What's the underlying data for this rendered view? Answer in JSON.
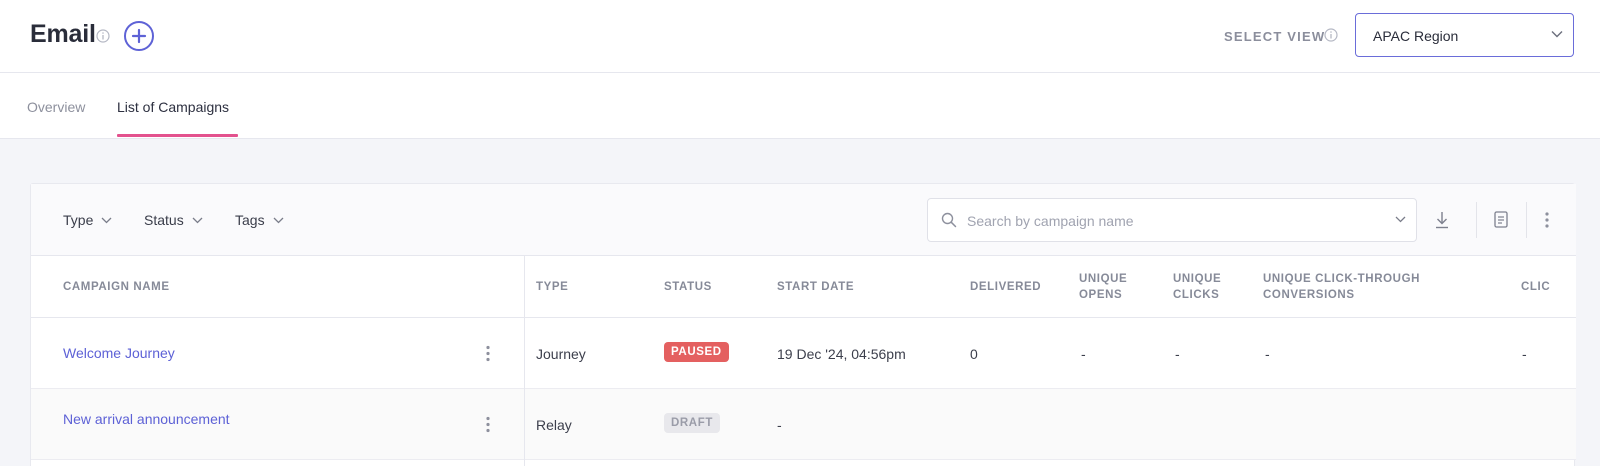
{
  "header": {
    "title": "Email",
    "select_view_label": "SELECT VIEW",
    "selected_view": "APAC Region"
  },
  "tabs": [
    {
      "label": "Overview",
      "active": false
    },
    {
      "label": "List of Campaigns",
      "active": true
    }
  ],
  "toolbar": {
    "filters": [
      "Type",
      "Status",
      "Tags"
    ],
    "search_placeholder": "Search by campaign name"
  },
  "table": {
    "columns": [
      "CAMPAIGN NAME",
      "TYPE",
      "STATUS",
      "START DATE",
      "DELIVERED",
      "UNIQUE\nOPENS",
      "UNIQUE\nCLICKS",
      "UNIQUE CLICK-THROUGH\nCONVERSIONS",
      "CLIC"
    ],
    "rows": [
      {
        "name": "Welcome Journey",
        "type": "Journey",
        "status": "PAUSED",
        "start_date": "19 Dec '24, 04:56pm",
        "delivered": "0",
        "unique_opens": "-",
        "unique_clicks": "-",
        "unique_ctc": "-",
        "clicks": "-"
      },
      {
        "name": "New arrival announcement",
        "type": "Relay",
        "status": "DRAFT",
        "start_date": "-"
      }
    ]
  },
  "colors": {
    "accent": "#5e62d6",
    "tab_underline": "#e3528e",
    "paused": "#e46060",
    "draft_bg": "#e8e8ec"
  }
}
